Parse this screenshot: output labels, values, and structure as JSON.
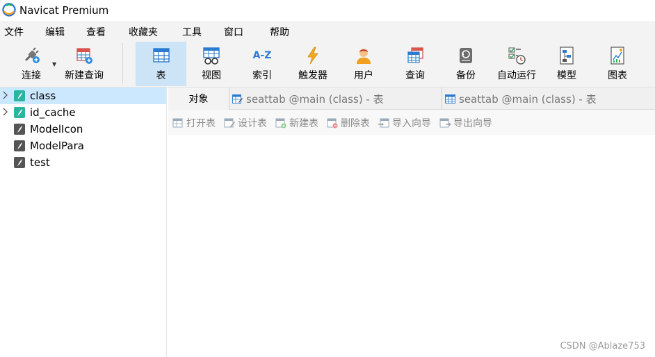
{
  "window": {
    "title": "Navicat Premium"
  },
  "menu": [
    "文件",
    "编辑",
    "查看",
    "收藏夹",
    "工具",
    "窗口",
    "帮助"
  ],
  "toolbar": {
    "connect": "连接",
    "new_query": "新建查询",
    "table": "表",
    "view": "视图",
    "index": "索引",
    "trigger": "触发器",
    "user": "用户",
    "query": "查询",
    "backup": "备份",
    "automation": "自动运行",
    "model": "模型",
    "chart": "图表",
    "index_icon_text": "A-Z"
  },
  "sidebar": {
    "items": [
      {
        "label": "class",
        "expandable": true,
        "selected": true,
        "color": "#2bb5a0"
      },
      {
        "label": "id_cache",
        "expandable": true,
        "selected": false,
        "color": "#2bb5a0"
      },
      {
        "label": "ModelIcon",
        "expandable": false,
        "selected": false,
        "color": "#555555"
      },
      {
        "label": "ModelPara",
        "expandable": false,
        "selected": false,
        "color": "#555555"
      },
      {
        "label": "test",
        "expandable": false,
        "selected": false,
        "color": "#555555"
      }
    ]
  },
  "tabs": {
    "objects": "对象",
    "doc1": "seattab @main (class) - 表",
    "doc2": "seattab @main (class) - 表"
  },
  "object_toolbar": {
    "open": "打开表",
    "design": "设计表",
    "new": "新建表",
    "delete": "删除表",
    "import": "导入向导",
    "export": "导出向导"
  },
  "watermark": "CSDN @Ablaze753",
  "colors": {
    "accent": "#cde4f6",
    "selection": "#cce8ff",
    "toolbar_bg": "#f3f3f3"
  }
}
